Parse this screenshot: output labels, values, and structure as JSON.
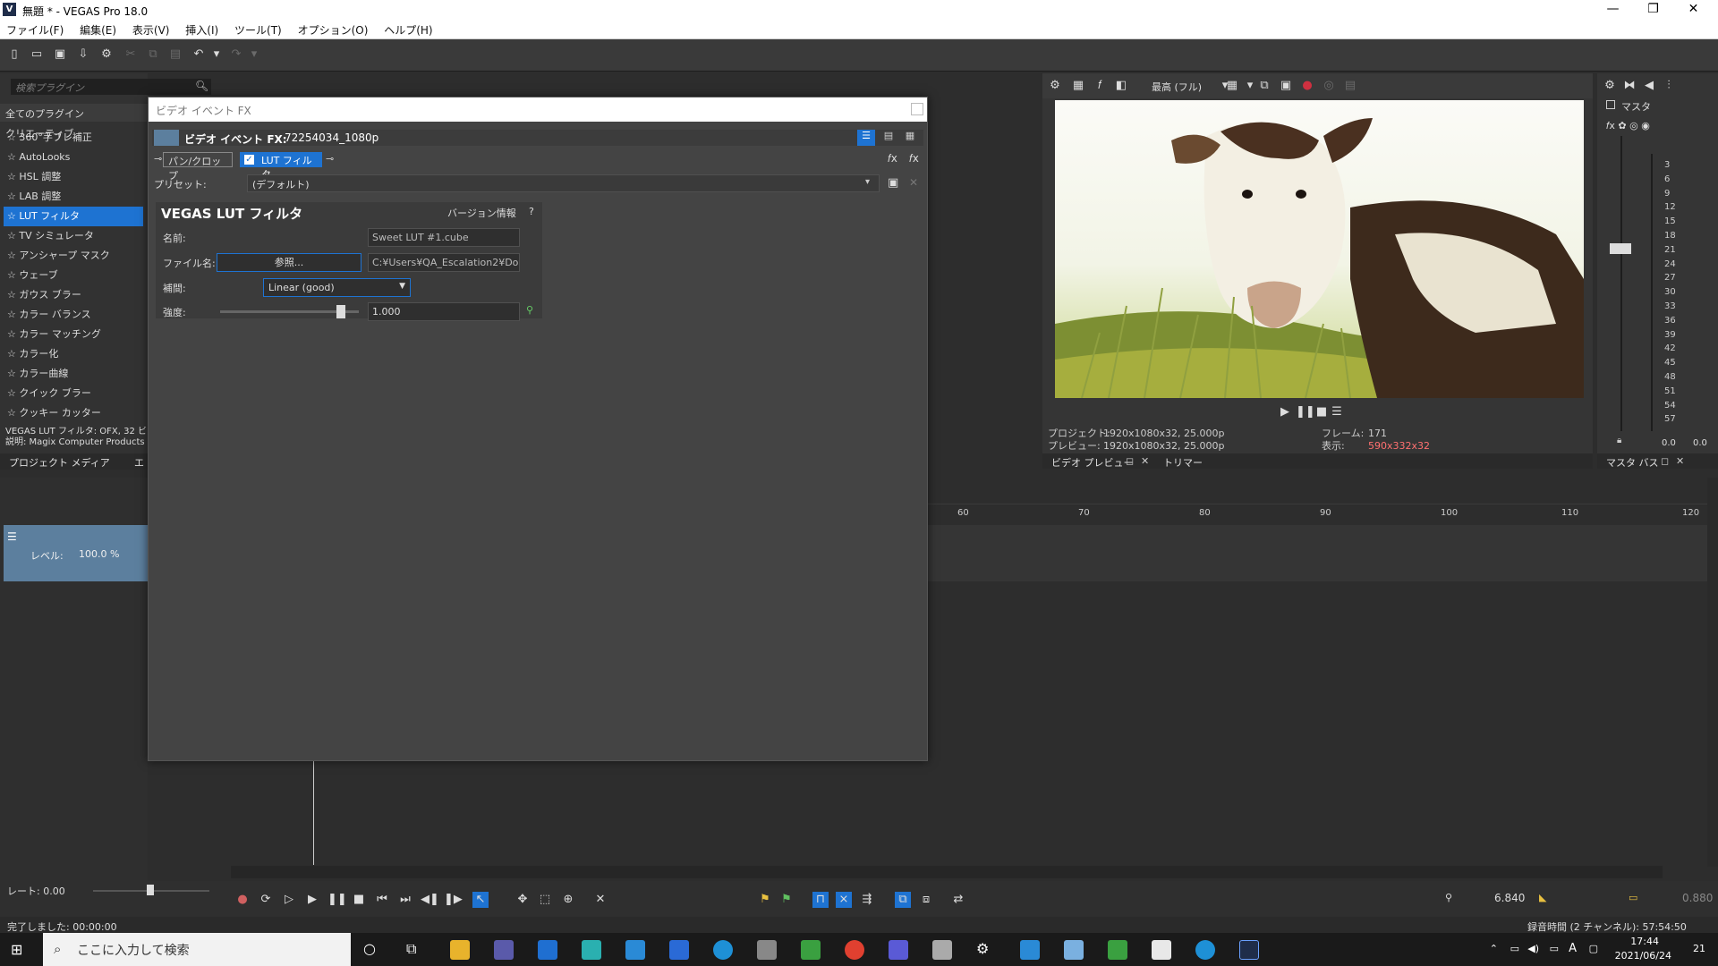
{
  "window": {
    "title": "無題 * - VEGAS Pro 18.0",
    "app_icon": "V",
    "minimize": "—",
    "maximize": "❐",
    "close": "✕"
  },
  "menu": [
    "ファイル(F)",
    "編集(E)",
    "表示(V)",
    "挿入(I)",
    "ツール(T)",
    "オプション(O)",
    "ヘルプ(H)"
  ],
  "plugins": {
    "search_placeholder": "検索プラグイン",
    "tabs": [
      "全てのプラグイン",
      "クリエーティブ"
    ],
    "items": [
      "360°手ブレ補正",
      "AutoLooks",
      "HSL 調整",
      "LAB 調整",
      "LUT フィルタ",
      "TV シミュレータ",
      "アンシャープ マスク",
      "ウェーブ",
      "ガウス ブラー",
      "カラー バランス",
      "カラー マッチング",
      "カラー化",
      "カラー曲線",
      "クイック ブラー",
      "クッキー カッター"
    ],
    "selected_index": 4,
    "desc_line1": "VEGAS LUT フィルタ: OFX, 32 ビ",
    "desc_line2": "説明: Magix Computer Products",
    "bottom_tab1": "プロジェクト メディア",
    "bottom_tab2": "エ"
  },
  "track": {
    "level_label": "レベル:",
    "level_value": "100.0 %"
  },
  "dialog": {
    "title": "ビデオ イベント FX",
    "fx_label": "ビデオ イベント FX:",
    "fx_name": "72254034_1080p",
    "chain": [
      "パン/クロップ",
      "LUT フィルタ"
    ],
    "preset_label": "プリセット:",
    "preset_value": "(デフォルト)",
    "plugin_title": "VEGAS LUT フィルタ",
    "version_info": "バージョン情報",
    "help": "?",
    "fields": {
      "name_label": "名前:",
      "name_value": "Sweet LUT #1.cube",
      "file_label": "ファイル名:",
      "browse_button": "参照...",
      "file_value": "C:¥Users¥QA_Escalation2¥Dow",
      "interp_label": "補間:",
      "interp_value": "Linear (good)",
      "strength_label": "強度:",
      "strength_value": "1.000",
      "strength_level": 0.9
    }
  },
  "preview": {
    "quality": "最高 (フル)",
    "project_label": "プロジェクト:",
    "project_value": "1920x1080x32, 25.000p",
    "preview_label": "プレビュー:",
    "preview_value": "1920x1080x32, 25.000p",
    "frame_label": "フレーム:",
    "frame_value": "171",
    "display_label": "表示:",
    "display_value": "590x332x32",
    "tab1": "ビデオ プレビュー",
    "tab2": "トリマー"
  },
  "master": {
    "title": "マスタ",
    "scale": [
      "3",
      "6",
      "9",
      "12",
      "15",
      "18",
      "21",
      "24",
      "27",
      "30",
      "33",
      "36",
      "39",
      "42",
      "45",
      "48",
      "51",
      "54",
      "57"
    ],
    "value_l": "0.0",
    "value_r": "0.0",
    "tab": "マスタ バス"
  },
  "timeline": {
    "ruler": [
      "60",
      "70",
      "80",
      "90",
      "100",
      "110",
      "120"
    ]
  },
  "transport": {
    "rate_label": "レート: 0.00",
    "time_value": "6.840",
    "right_value": "0.880"
  },
  "status": {
    "left": "完了しました: 00:00:00",
    "right": "録音時間 (2 チャンネル): 57:54:50"
  },
  "taskbar": {
    "search": "ここに入力して検索",
    "time": "17:44",
    "date": "2021/06/24",
    "ime": "A",
    "notif": "21"
  },
  "colors": {
    "accent": "#1e73d2",
    "display_value": "#ff7070"
  }
}
